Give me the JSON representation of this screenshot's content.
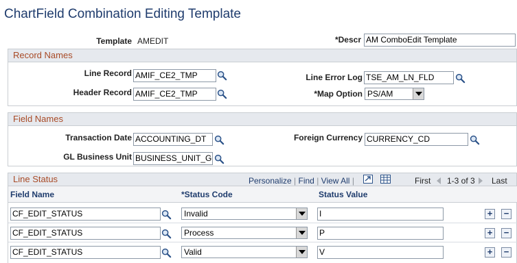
{
  "page": {
    "title": "ChartField Combination Editing Template"
  },
  "header": {
    "template_label": "Template",
    "template_value": "AMEDIT",
    "descr_label": "*Descr",
    "descr_value": "AM ComboEdit Template"
  },
  "record_names": {
    "title": "Record Names",
    "line_record_label": "Line Record",
    "line_record_value": "AMIF_CE2_TMP",
    "header_record_label": "Header Record",
    "header_record_value": "AMIF_CE2_TMP",
    "line_error_log_label": "Line Error Log",
    "line_error_log_value": "TSE_AM_LN_FLD",
    "map_option_label": "*Map Option",
    "map_option_value": "PS/AM"
  },
  "field_names": {
    "title": "Field Names",
    "transaction_date_label": "Transaction Date",
    "transaction_date_value": "ACCOUNTING_DT",
    "gl_business_unit_label": "GL Business Unit",
    "gl_business_unit_value": "BUSINESS_UNIT_GL",
    "foreign_currency_label": "Foreign Currency",
    "foreign_currency_value": "CURRENCY_CD"
  },
  "line_status": {
    "title": "Line Status",
    "toolbar": {
      "personalize": "Personalize",
      "sep1": "|",
      "find": "Find",
      "sep2": "|",
      "view_all": "View All",
      "sep3": "|",
      "first": "First",
      "range": "1-3 of 3",
      "last": "Last"
    },
    "columns": [
      "Field Name",
      "*Status Code",
      "Status Value"
    ],
    "rows": [
      {
        "field_name": "CF_EDIT_STATUS",
        "status_code": "Invalid",
        "status_value": "I"
      },
      {
        "field_name": "CF_EDIT_STATUS",
        "status_code": "Process",
        "status_value": "P"
      },
      {
        "field_name": "CF_EDIT_STATUS",
        "status_code": "Valid",
        "status_value": "V"
      }
    ],
    "add_symbol": "+",
    "delete_symbol": "−"
  },
  "icons": {
    "lookup": "magnifier-icon",
    "zoom": "zoom-grid-icon",
    "download": "download-to-excel-icon",
    "first": "first-arrow-icon",
    "last": "last-arrow-icon",
    "add": "add-row-icon",
    "delete": "delete-row-icon"
  },
  "colors": {
    "title": "#1f3c6d",
    "section_title": "#a84a26",
    "section_bg": "#e6e9ee",
    "link": "#1f3c6d"
  }
}
